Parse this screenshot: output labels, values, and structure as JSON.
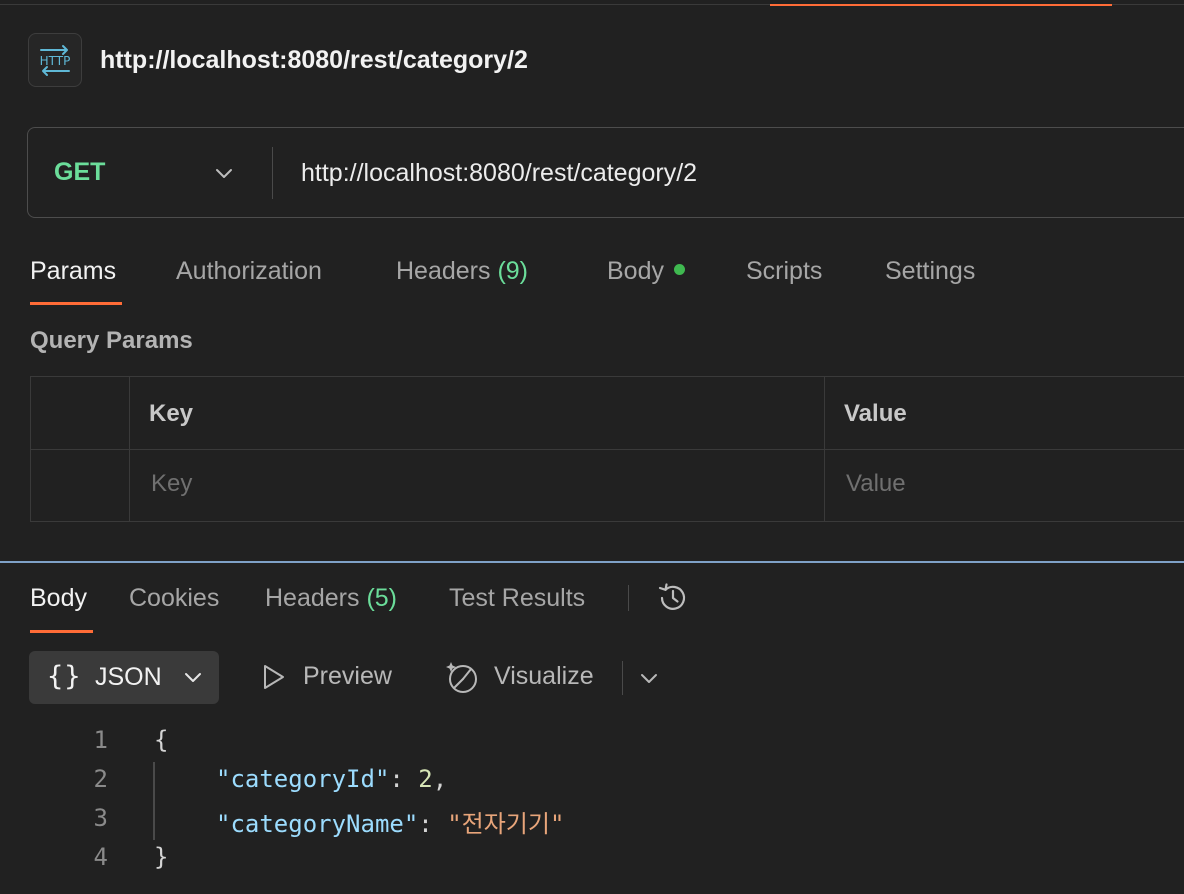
{
  "request": {
    "title": "http://localhost:8080/rest/category/2",
    "badge_label": "HTTP",
    "method": "GET",
    "url": "http://localhost:8080/rest/category/2"
  },
  "request_tabs": {
    "params": "Params",
    "authorization": "Authorization",
    "headers": "Headers",
    "headers_count": "(9)",
    "body": "Body",
    "scripts": "Scripts",
    "settings": "Settings"
  },
  "query_params": {
    "section_label": "Query Params",
    "columns": {
      "key": "Key",
      "value": "Value"
    },
    "placeholder_row": {
      "key": "Key",
      "value": "Value"
    }
  },
  "response_tabs": {
    "body": "Body",
    "cookies": "Cookies",
    "headers": "Headers",
    "headers_count": "(5)",
    "test_results": "Test Results"
  },
  "response_toolbar": {
    "format": "JSON",
    "preview": "Preview",
    "visualize": "Visualize"
  },
  "response_body": {
    "line_numbers": [
      "1",
      "2",
      "3",
      "4"
    ],
    "open_brace": "{",
    "close_brace": "}",
    "fields": [
      {
        "key": "\"categoryId\"",
        "value": "2",
        "trail": ","
      },
      {
        "key": "\"categoryName\"",
        "value": "\"전자기기\"",
        "trail": ""
      }
    ]
  },
  "colors": {
    "accent": "#ff6c37",
    "method_get": "#6bdd9a",
    "body_dot": "#3fb950",
    "split_line": "#7fa1c7"
  }
}
